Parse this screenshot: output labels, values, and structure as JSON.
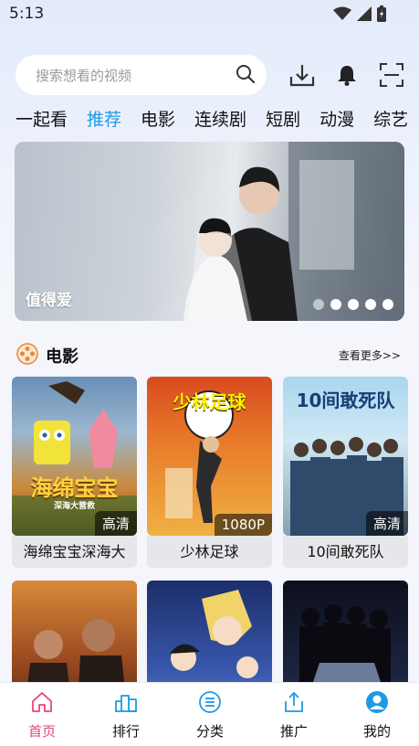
{
  "status_bar": {
    "time": "5:13"
  },
  "search": {
    "placeholder": "搜索想看的视频"
  },
  "tabs": [
    {
      "label": "一起看",
      "active": false
    },
    {
      "label": "推荐",
      "active": true
    },
    {
      "label": "电影",
      "active": false
    },
    {
      "label": "连续剧",
      "active": false
    },
    {
      "label": "短剧",
      "active": false
    },
    {
      "label": "动漫",
      "active": false
    },
    {
      "label": "综艺",
      "active": false
    }
  ],
  "banner": {
    "caption": "值得爱",
    "dots": 5,
    "active_dot": 0
  },
  "section": {
    "title": "电影",
    "more": "查看更多>>"
  },
  "movies": [
    {
      "title": "海绵宝宝深海大",
      "quality": "高清",
      "poster_text": "海绵宝宝",
      "poster_subtext": "深海大营救"
    },
    {
      "title": "少林足球",
      "quality": "1080P",
      "poster_text": "少林足球",
      "poster_subtext": ""
    },
    {
      "title": "10间敢死队",
      "quality": "高清",
      "poster_text": "10间敢死队",
      "poster_subtext": ""
    },
    {
      "title": "",
      "quality": "",
      "poster_text": "",
      "poster_subtext": ""
    },
    {
      "title": "",
      "quality": "",
      "poster_text": "",
      "poster_subtext": ""
    },
    {
      "title": "",
      "quality": "",
      "poster_text": "",
      "poster_subtext": ""
    }
  ],
  "bottom_nav": [
    {
      "label": "首页",
      "icon": "home-icon",
      "active": true
    },
    {
      "label": "排行",
      "icon": "ranking-icon",
      "active": false
    },
    {
      "label": "分类",
      "icon": "category-icon",
      "active": false
    },
    {
      "label": "推广",
      "icon": "share-icon",
      "active": false
    },
    {
      "label": "我的",
      "icon": "profile-icon",
      "active": false
    }
  ],
  "colors": {
    "accent": "#1e9ae5",
    "active_nav": "#e6477a",
    "background": "#f4f6fb"
  }
}
